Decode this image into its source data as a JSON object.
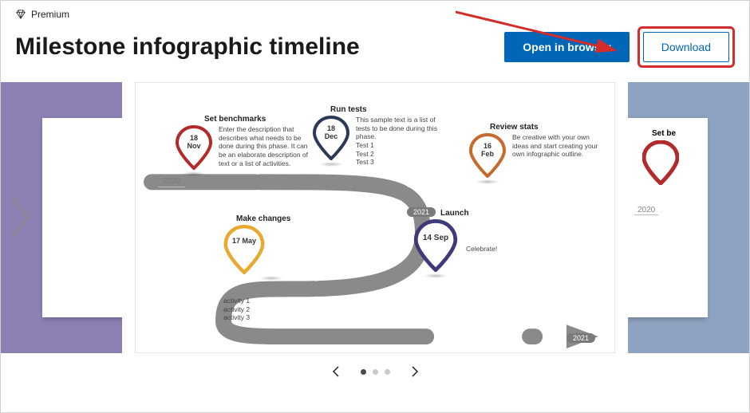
{
  "premium_label": "Premium",
  "title": "Milestone infographic timeline",
  "buttons": {
    "open": "Open in browser",
    "download": "Download"
  },
  "timeline": {
    "start_year": "2020",
    "mid_year": "2021",
    "end_year": "2021",
    "milestones": [
      {
        "title": "Set benchmarks",
        "date_top": "18",
        "date_bottom": "Nov",
        "desc": "Enter the description that describes what needs to be done during this phase. It can be an elaborate description of text or a list of activities.",
        "color": "#b22a2a"
      },
      {
        "title": "Run tests",
        "date_top": "18",
        "date_bottom": "Dec",
        "desc": "This sample text is a list of tests to be done during this phase.\nTest 1\nTest 2\nTest 3",
        "color": "#2d3a57"
      },
      {
        "title": "Review stats",
        "date_top": "16",
        "date_bottom": "Feb",
        "desc": "Be creative with your own ideas and start creating your own infographic outline.",
        "color": "#c76a2e"
      },
      {
        "title": "Make changes",
        "date_top": "17 May",
        "date_bottom": "",
        "desc": "activity 1\nactivity 2\nactivity 3",
        "color": "#e8a92e"
      },
      {
        "title": "Launch",
        "date_top": "14 Sep",
        "date_bottom": "",
        "desc": "Celebrate!",
        "color": "#3e3a7a"
      }
    ]
  },
  "peek_right": {
    "title": "Set be",
    "year": "2020"
  },
  "carousel": {
    "index": 0,
    "total": 3
  }
}
